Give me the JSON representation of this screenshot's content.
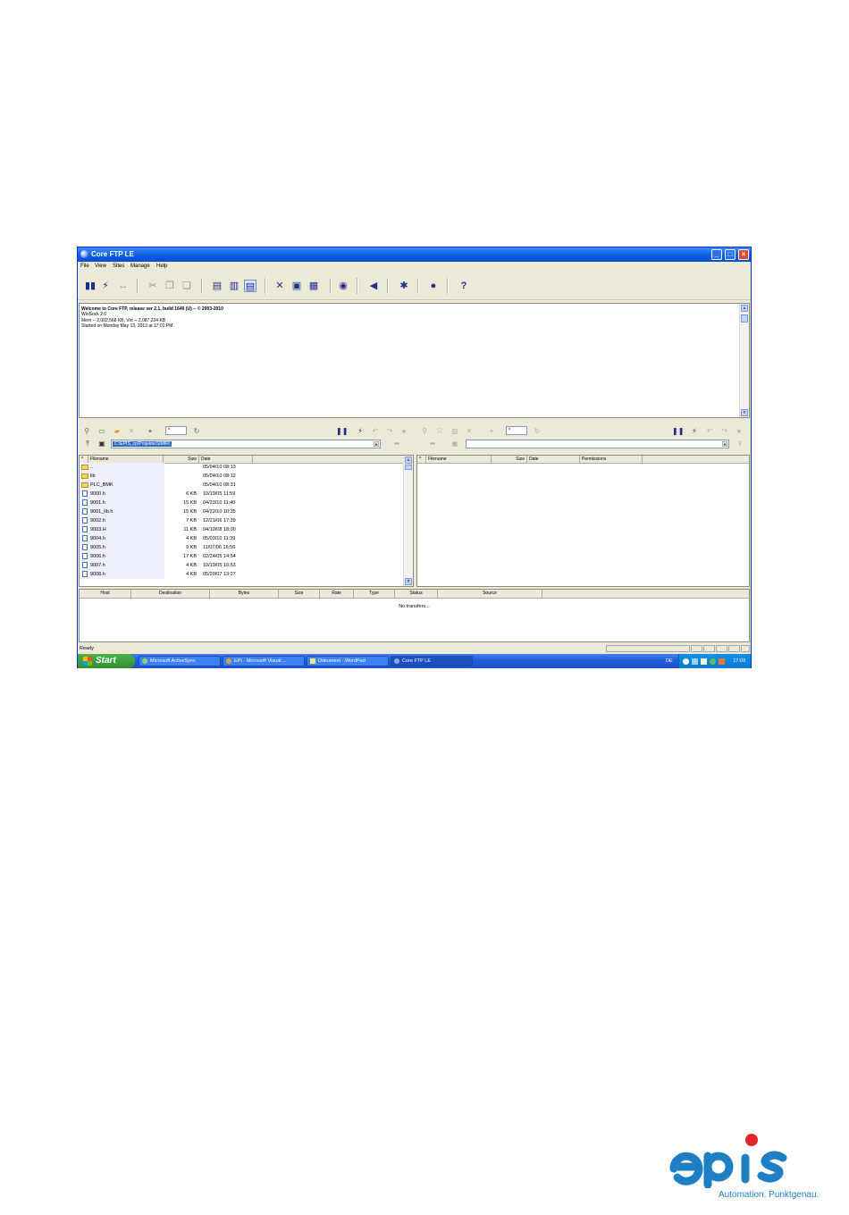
{
  "window": {
    "title": "Core FTP LE",
    "controls": {
      "minimize": "_",
      "maximize": "□",
      "close": "×"
    }
  },
  "menu": [
    "File",
    "View",
    "Sites",
    "Manage",
    "Help"
  ],
  "toolbar_icons": [
    "connect-icon",
    "quick-connect-icon",
    "disconnect-icon",
    "cut-icon",
    "copy-icon",
    "paste-icon",
    "view-doc-icon",
    "view-log-icon",
    "view-list-icon",
    "tools-icon",
    "site-manager-icon",
    "queue-icon",
    "eye-icon",
    "sound-icon",
    "settings-icon",
    "info-icon",
    "help-icon"
  ],
  "log": {
    "lines": [
      "Welcome to Core FTP, release ver 2.1, build 1640 (U) -- © 2003-2010",
      "WinSock 2.0",
      "Mem -- 2,002,568 KB, Virt -- 2,087,224 KB",
      "Started on Monday May 13, 2013 at 17:01:PM"
    ]
  },
  "local_pane": {
    "filter": "*",
    "path": "C:\\EPIS_cp\\Projekte\\SIMIR\\",
    "columns": [
      "Filename",
      "Size",
      "Date"
    ],
    "files": [
      {
        "name": "..",
        "type": "folder",
        "size": "",
        "date": "05/04/10  08:13"
      },
      {
        "name": "lib",
        "type": "folder",
        "size": "",
        "date": "05/04/10  08:12"
      },
      {
        "name": "PLC_BMK",
        "type": "folder",
        "size": "",
        "date": "05/04/10  08:31"
      },
      {
        "name": "9000.h",
        "type": "file",
        "size": "6 KB",
        "date": "10/19/05  11:59"
      },
      {
        "name": "9001.h",
        "type": "file",
        "size": "15 KB",
        "date": "04/23/10  11:40"
      },
      {
        "name": "9001_lib.h",
        "type": "file",
        "size": "15 KB",
        "date": "04/22/10  10:35"
      },
      {
        "name": "9002.h",
        "type": "file",
        "size": "7 KB",
        "date": "12/21/06  17:39"
      },
      {
        "name": "9003.H",
        "type": "file",
        "size": "11 KB",
        "date": "04/10/08  18:00"
      },
      {
        "name": "9004.h",
        "type": "file",
        "size": "4 KB",
        "date": "05/03/10  11:39"
      },
      {
        "name": "9005.h",
        "type": "file",
        "size": "9 KB",
        "date": "11/07/06  16:56"
      },
      {
        "name": "9006.h",
        "type": "file",
        "size": "17 KB",
        "date": "02/24/05  14:54"
      },
      {
        "name": "9007.h",
        "type": "file",
        "size": "4 KB",
        "date": "10/19/05  10:53"
      },
      {
        "name": "9008.h",
        "type": "file",
        "size": "4 KB",
        "date": "05/20/07  13:27"
      }
    ]
  },
  "remote_pane": {
    "filter": "*",
    "path": "",
    "columns": [
      "Filename",
      "Size",
      "Date",
      "Permissions"
    ]
  },
  "transfers": {
    "columns": [
      "Host",
      "Destination",
      "Bytes",
      "Size",
      "Rate",
      "Type",
      "Status",
      "Source"
    ],
    "empty_text": "No transfers..."
  },
  "status": {
    "text": "Ready"
  },
  "taskbar": {
    "start_label": "Start",
    "tasks": [
      {
        "label": "Microsoft ActiveSync",
        "active": false
      },
      {
        "label": "EPI - Microsoft Visual ...",
        "active": false
      },
      {
        "label": "Dokument - WordPad",
        "active": false
      },
      {
        "label": "Core FTP LE",
        "active": true
      }
    ],
    "language": "DE",
    "clock": "17:03"
  },
  "logo": {
    "brand": "epis",
    "tagline": "Automation. Punktgenau.",
    "colors": {
      "blue": "#1f7fc4",
      "red": "#e4262b"
    }
  }
}
